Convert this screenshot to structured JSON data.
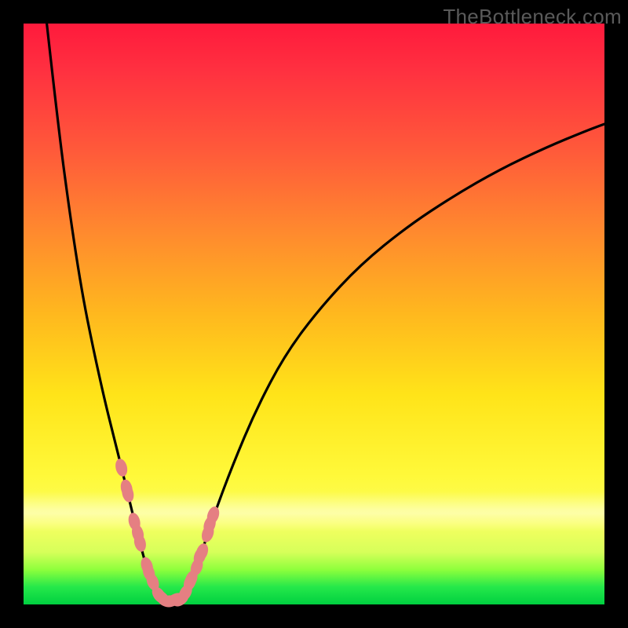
{
  "watermark": "TheBottleneck.com",
  "chart_data": {
    "type": "line",
    "title": "",
    "xlabel": "",
    "ylabel": "",
    "xlim": [
      0,
      100
    ],
    "ylim": [
      0,
      100
    ],
    "grid": false,
    "legend": false,
    "series": [
      {
        "name": "left-branch",
        "x": [
          4,
          6,
          8,
          10,
          12,
          14,
          15.5,
          17,
          18.2,
          19.3,
          20.2,
          21,
          21.8,
          22.6,
          23.4
        ],
        "y": [
          100,
          82,
          67,
          54,
          44,
          35,
          29,
          23,
          18,
          13.5,
          10,
          7,
          4.5,
          2.5,
          1
        ]
      },
      {
        "name": "bottom-dip",
        "x": [
          23.4,
          24.1,
          24.8,
          25.6,
          26.5,
          27.4
        ],
        "y": [
          1,
          0.4,
          0.2,
          0.2,
          0.5,
          1.2
        ]
      },
      {
        "name": "right-branch",
        "x": [
          27.4,
          28.4,
          29.6,
          31,
          33,
          36,
          40,
          45,
          51,
          58,
          66,
          74,
          82,
          90,
          97,
          100
        ],
        "y": [
          1.2,
          3,
          6,
          10,
          16,
          24,
          33.5,
          43,
          51,
          58.5,
          65,
          70.3,
          74.9,
          78.7,
          81.6,
          82.7
        ]
      }
    ],
    "annotations": {
      "beads_note": "Pink oval beads cluster along both branches near the dip and a few along the flat bottom.",
      "gradient": [
        "#ff1a3c",
        "#ff8a2e",
        "#ffe419",
        "#25e84a"
      ]
    },
    "beads": {
      "left": {
        "x_range": [
          16.5,
          23.4
        ],
        "count": 10
      },
      "bottom": {
        "x_range": [
          23.6,
          27.2
        ],
        "count": 5
      },
      "right": {
        "x_range": [
          27.6,
          33.0
        ],
        "count": 9
      }
    }
  }
}
